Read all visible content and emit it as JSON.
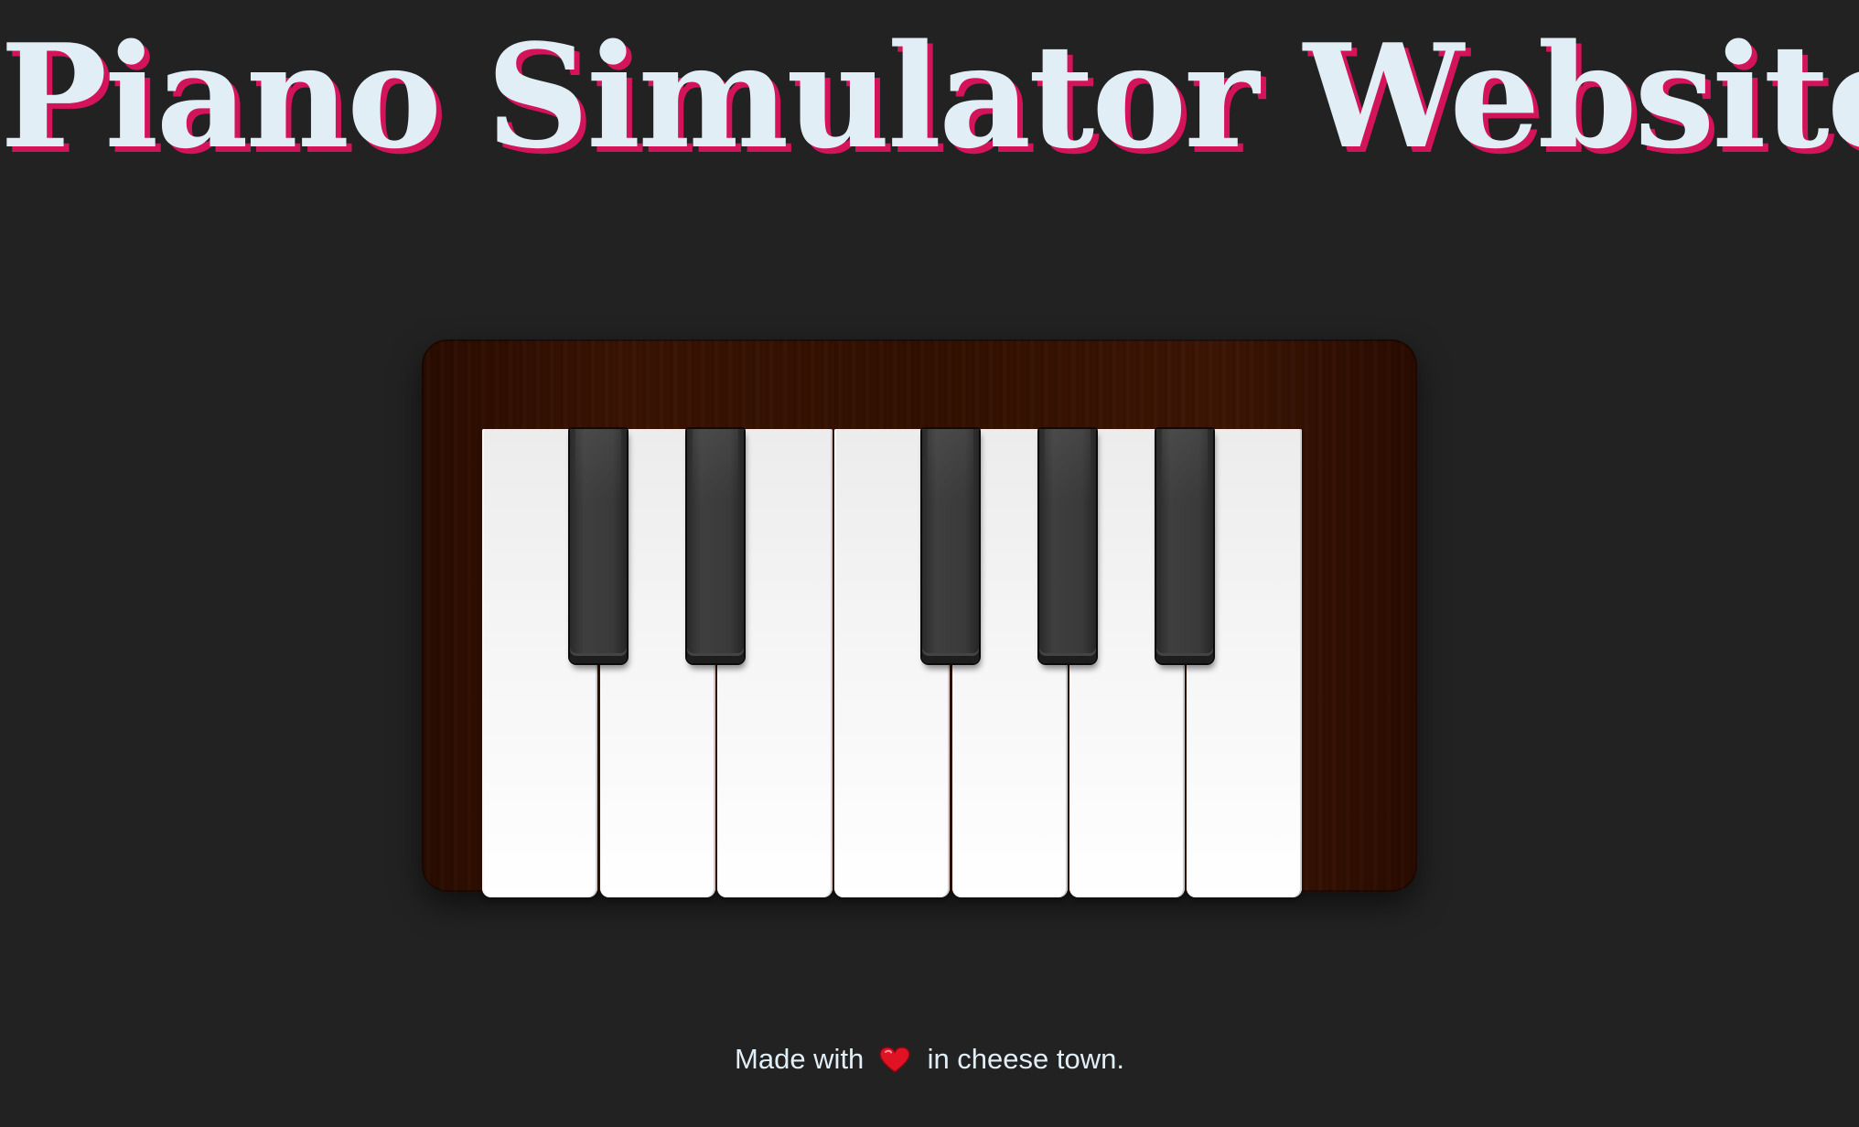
{
  "header": {
    "title": "Piano Simulator Website"
  },
  "piano": {
    "white_keys": 7,
    "black_keys": 5
  },
  "footer": {
    "text_before": "Made with",
    "icon": "heart-icon",
    "text_after": "in cheese town."
  },
  "colors": {
    "background": "#222222",
    "title_text": "#e1eef6",
    "title_shadow": "#d4145a",
    "piano_wood": "#331000",
    "heart": "#e01324"
  }
}
